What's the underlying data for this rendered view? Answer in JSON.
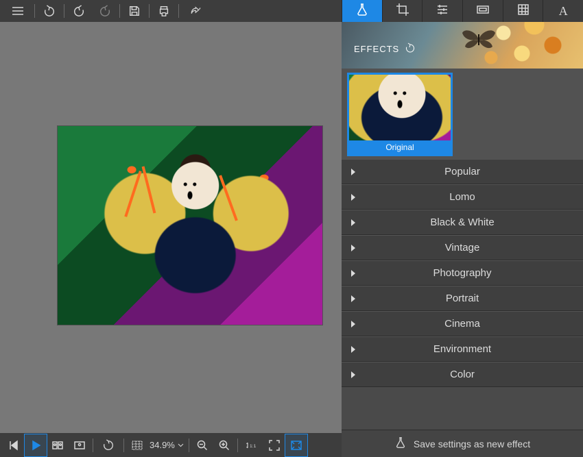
{
  "sidebar": {
    "title": "EFFECTS",
    "thumb_label": "Original",
    "categories": [
      {
        "label": "Popular"
      },
      {
        "label": "Lomo"
      },
      {
        "label": "Black & White"
      },
      {
        "label": "Vintage"
      },
      {
        "label": "Photography"
      },
      {
        "label": "Portrait"
      },
      {
        "label": "Cinema"
      },
      {
        "label": "Environment"
      },
      {
        "label": "Color"
      }
    ],
    "footer_label": "Save settings as new effect"
  },
  "bottom": {
    "zoom": "34.9%"
  },
  "colors": {
    "accent": "#1e88e5",
    "chrome": "#3d3d3d",
    "panel": "#4a4a4a"
  },
  "modes": {
    "active": "effects"
  }
}
